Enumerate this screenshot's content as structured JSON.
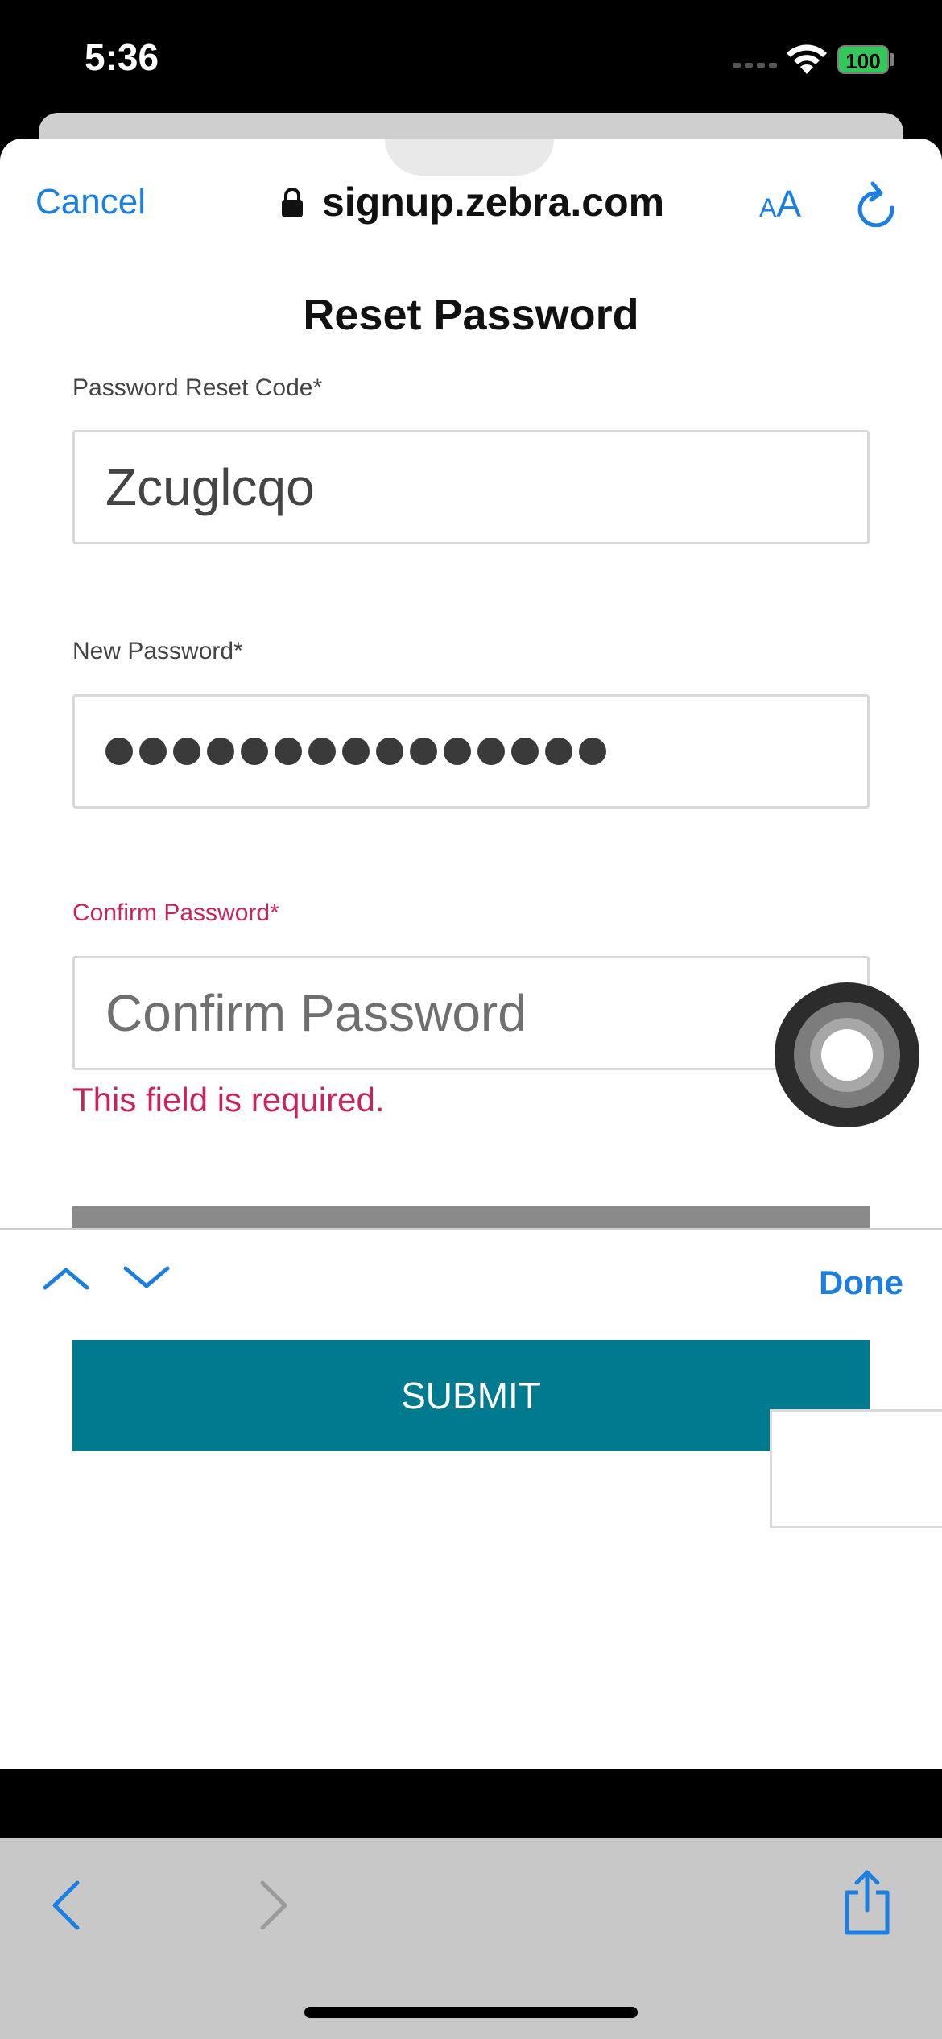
{
  "status_bar": {
    "time": "5:36",
    "battery": "100"
  },
  "browser_header": {
    "cancel_label": "Cancel",
    "url": "signup.zebra.com",
    "text_size_label_small": "A",
    "text_size_label_large": "A",
    "icons": {
      "lock": "lock-icon",
      "reload": "reload-icon"
    }
  },
  "form": {
    "title": "Reset Password",
    "reset_code": {
      "label": "Password Reset Code*",
      "value": "Zcuglcqo"
    },
    "new_password": {
      "label": "New Password*",
      "masked_length": 15
    },
    "confirm_password": {
      "label": "Confirm Password*",
      "placeholder": "Confirm Password",
      "error": "This field is required."
    },
    "submit_label": "SUBMIT"
  },
  "keyboard_toolbar": {
    "done_label": "Done",
    "icons": {
      "previous": "chevron-up-icon",
      "next": "chevron-down-icon"
    }
  },
  "bottom_toolbar": {
    "icons": {
      "back": "chevron-left-icon",
      "forward": "chevron-right-icon",
      "share": "share-icon"
    }
  },
  "colors": {
    "link_blue": "#1a7fe0",
    "error_red": "#c8245c",
    "submit_teal": "#007a8f"
  }
}
